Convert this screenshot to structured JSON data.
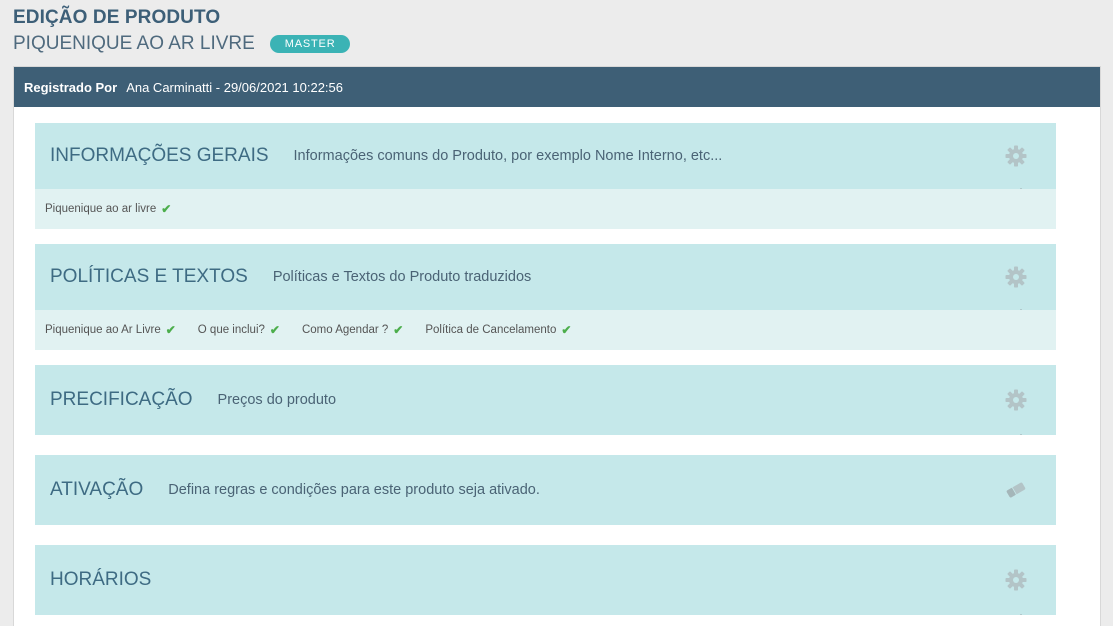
{
  "header": {
    "title": "EDIÇÃO DE PRODUTO",
    "product_name": "PIQUENIQUE AO AR LIVRE",
    "badge": "MASTER"
  },
  "registered": {
    "label": "Registrado Por",
    "value": "Ana Carminatti - 29/06/2021 10:22:56"
  },
  "sections": [
    {
      "title": "INFORMAÇÕES GERAIS",
      "description": "Informações comuns do Produto, por exemplo Nome Interno, etc...",
      "icon": "gear-icon",
      "items": [
        "Piquenique ao ar livre"
      ]
    },
    {
      "title": "POLÍTICAS E TEXTOS",
      "description": "Políticas e Textos do Produto traduzidos",
      "icon": "gear-icon",
      "items": [
        "Piquenique ao Ar Livre",
        "O que inclui?",
        "Como Agendar ?",
        "Política de Cancelamento"
      ]
    },
    {
      "title": "PRECIFICAÇÃO",
      "description": "Preços do produto",
      "icon": "gear-icon",
      "items": []
    },
    {
      "title": "ATIVAÇÃO",
      "description": "Defina regras e condições para este produto seja ativado.",
      "icon": "eraser-icon",
      "items": []
    },
    {
      "title": "HORÁRIOS",
      "description": "",
      "icon": "gear-icon",
      "items": []
    }
  ],
  "check_glyph": "✔",
  "colors": {
    "header_text": "#3d5f78",
    "badge_bg": "#3bb3b5",
    "bar_bg": "#3e5f76",
    "card_head_bg": "#c5e8ea",
    "card_body_bg": "#e1f2f2",
    "check": "#4cae4c"
  }
}
